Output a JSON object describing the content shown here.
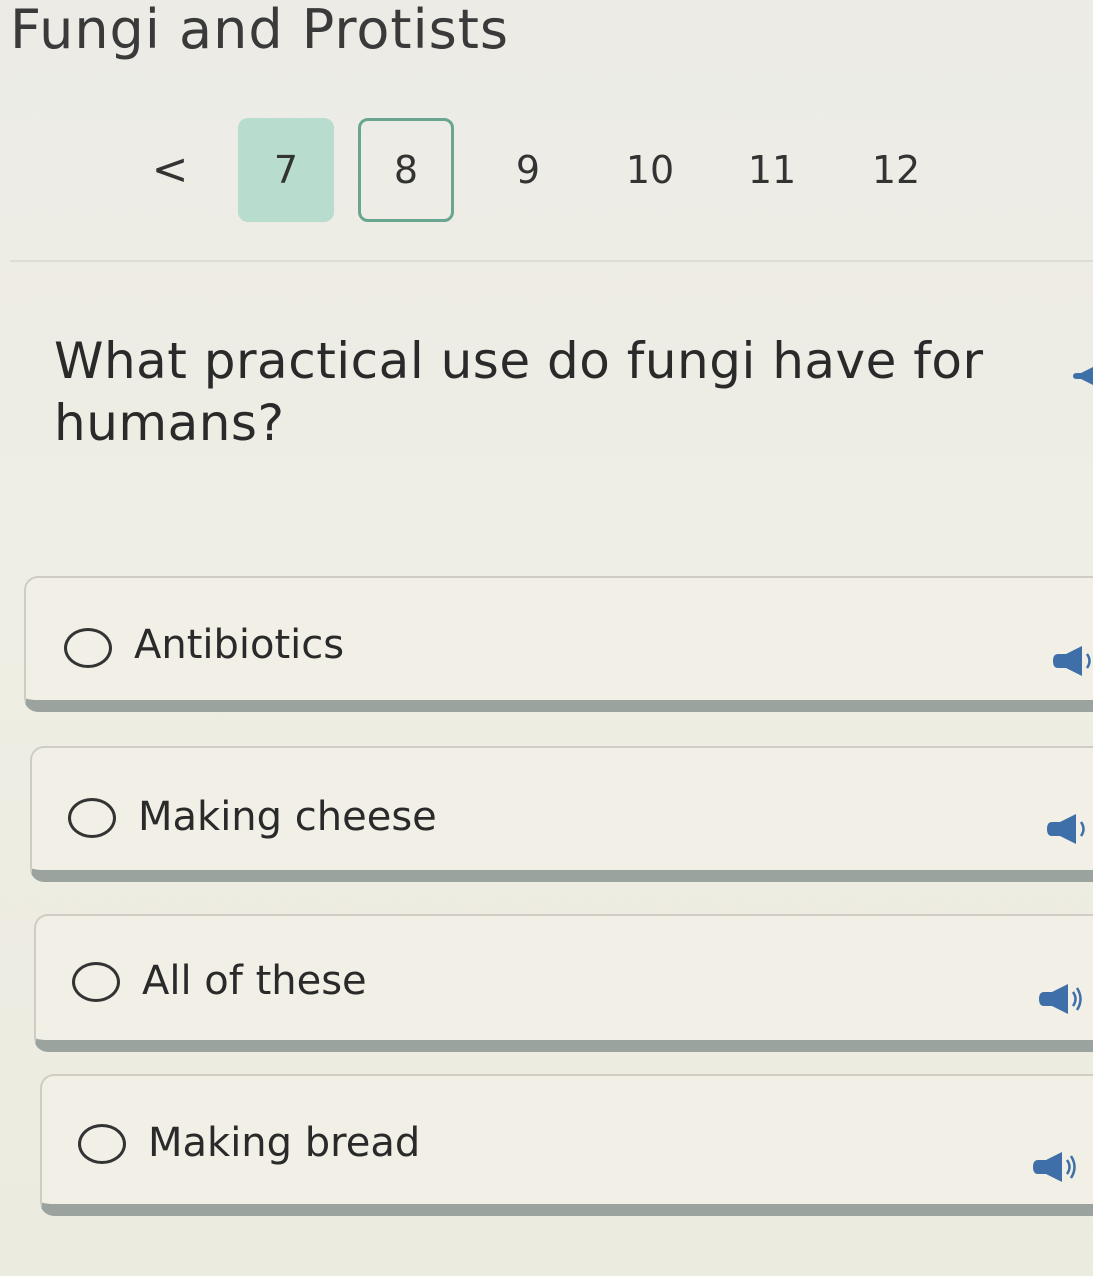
{
  "header": {
    "title": "Fungi and Protists"
  },
  "pager": {
    "prev_icon": "chevron-left-icon",
    "prev_glyph": "<",
    "pages": [
      "7",
      "8",
      "9",
      "10",
      "11",
      "12"
    ],
    "completed_page": "7",
    "current_page": "8"
  },
  "question": {
    "text": "What practical use do fungi have for humans?"
  },
  "options": [
    {
      "label": "Antibiotics"
    },
    {
      "label": "Making cheese"
    },
    {
      "label": "All of these"
    },
    {
      "label": "Making bread"
    }
  ],
  "colors": {
    "completed_page_bg": "#b8dccd",
    "current_page_border": "#6aa58f",
    "option_shadow": "#9aa39e"
  }
}
